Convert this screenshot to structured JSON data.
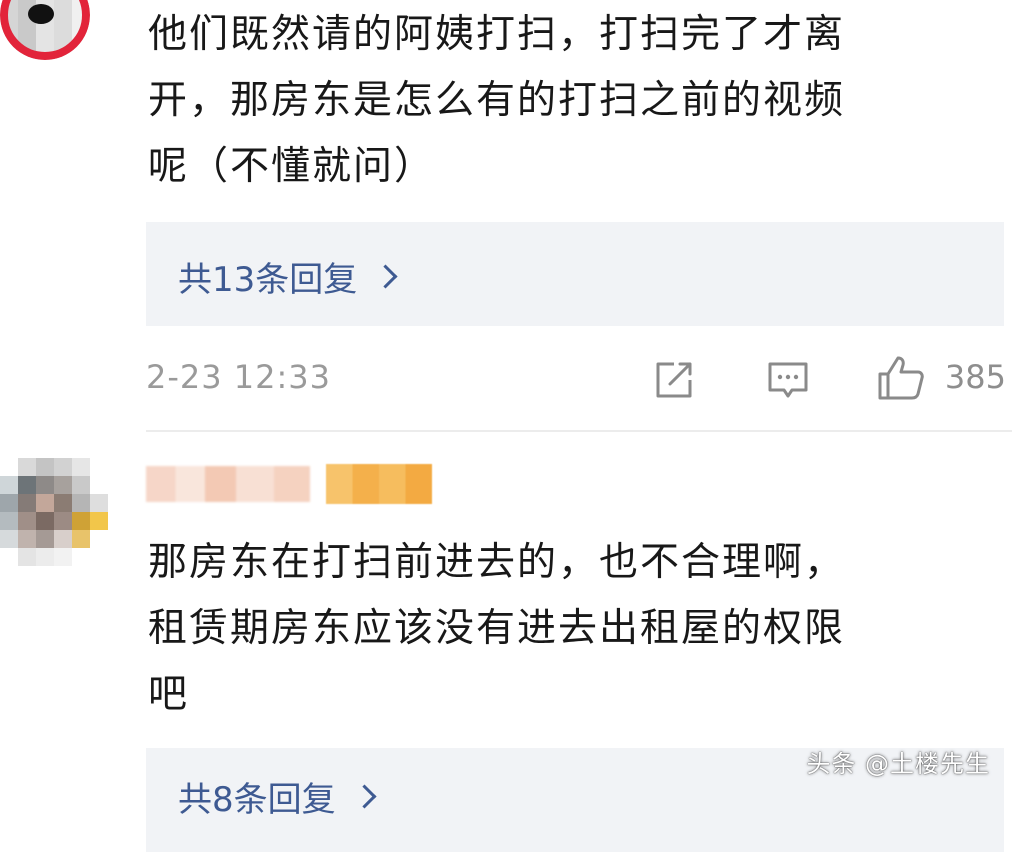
{
  "comments": [
    {
      "lines": [
        "他们既然请的阿姨打扫，打扫完了才离",
        "开，那房东是怎么有的打扫之前的视频",
        "呢（不懂就问）"
      ],
      "replies_label": "共13条回复",
      "timestamp": "2-23 12:33",
      "like_count": "385"
    },
    {
      "lines": [
        "那房东在打扫前进去的，也不合理啊，",
        "租赁期房东应该没有进去出租屋的权限",
        "吧"
      ],
      "replies_label": "共8条回复"
    }
  ],
  "icons": {
    "share": "share-icon",
    "comment": "comment-icon",
    "like": "thumbs-up-icon",
    "chevron": "chevron-right-icon"
  },
  "colors": {
    "link": "#3e5a92",
    "meta_gray": "#9a9a9a",
    "reply_box_bg": "#f1f3f6"
  },
  "watermark": "头条 @土楼先生"
}
